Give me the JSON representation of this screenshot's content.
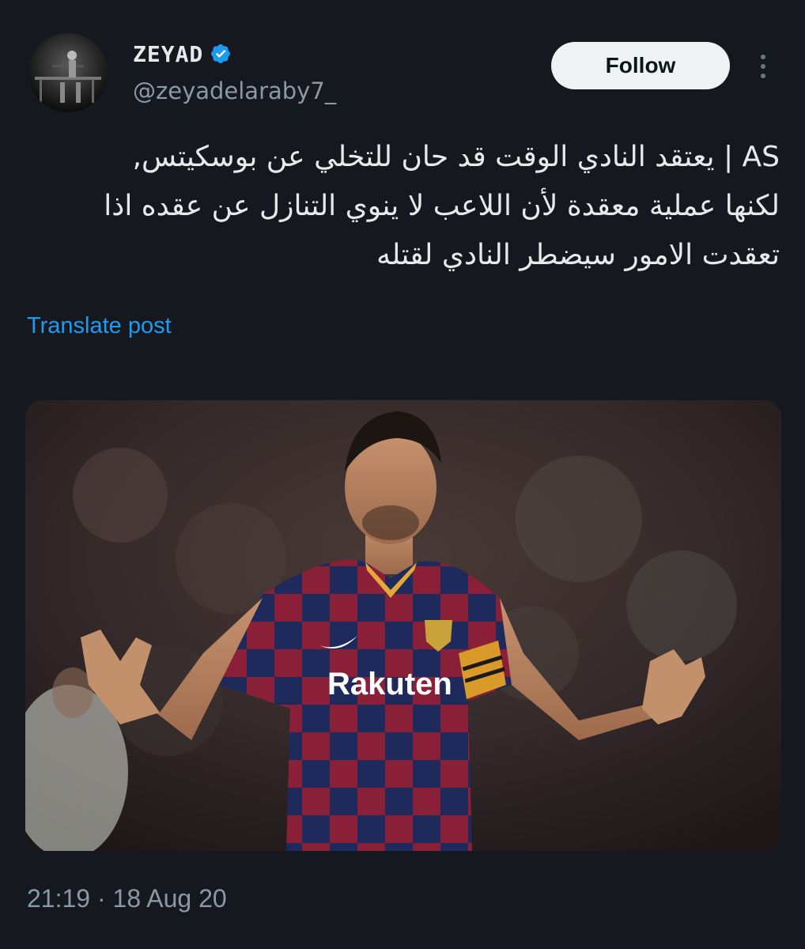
{
  "author": {
    "display_name": "ZEYAD",
    "handle": "@zeyadelaraby7_",
    "verified": true,
    "avatar_icon": "profile-avatar"
  },
  "actions": {
    "follow_label": "Follow",
    "more_icon": "more-vertical-icon"
  },
  "post": {
    "text_lines": [
      "AS | يعتقد النادي الوقت قد حان للتخلي عن بوسكيتس,",
      "لكنها عملية معقدة لأن اللاعب لا ينوي التنازل عن عقده اذا",
      "تعقدت الامور سيضطر النادي لقتله"
    ],
    "translate_label": "Translate post",
    "media": {
      "description": "photo-football-player",
      "shirt_sponsor": "Rakuten"
    },
    "timestamp": "21:19 · 18 Aug 20"
  },
  "colors": {
    "background": "#15181e",
    "link": "#1d9bf0",
    "verified": "#1d9bf0",
    "secondary_text": "#8b98a5",
    "follow_bg": "#eff3f4"
  }
}
